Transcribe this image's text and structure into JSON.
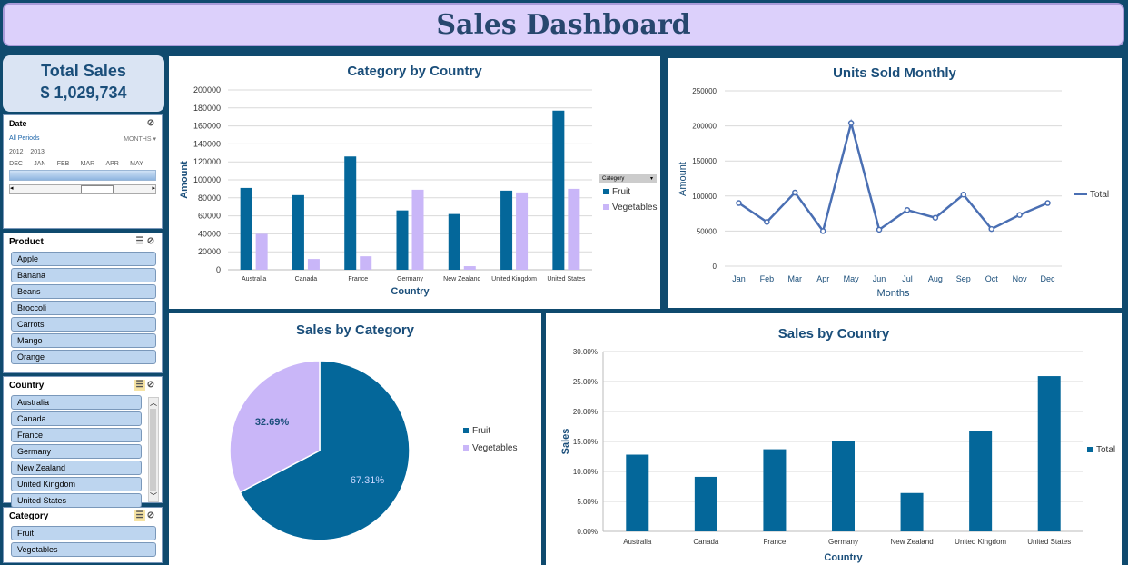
{
  "header": {
    "title": "Sales Dashboard"
  },
  "total_sales": {
    "label": "Total Sales",
    "value": "$ 1,029,734"
  },
  "date_slicer": {
    "title": "Date",
    "all_periods": "All Periods",
    "granularity": "MONTHS",
    "years": [
      "2012",
      "2013"
    ],
    "months": [
      "DEC",
      "JAN",
      "FEB",
      "MAR",
      "APR",
      "MAY"
    ]
  },
  "product_slicer": {
    "title": "Product",
    "items": [
      "Apple",
      "Banana",
      "Beans",
      "Broccoli",
      "Carrots",
      "Mango",
      "Orange"
    ]
  },
  "country_slicer": {
    "title": "Country",
    "items": [
      "Australia",
      "Canada",
      "France",
      "Germany",
      "New Zealand",
      "United Kingdom",
      "United States"
    ]
  },
  "category_slicer": {
    "title": "Category",
    "items": [
      "Fruit",
      "Vegetables"
    ]
  },
  "colors": {
    "fruit": "#04679a",
    "vegetables": "#c9b6f8",
    "line": "#4a6fb3",
    "accent": "#1a4e7a"
  },
  "chart_data": [
    {
      "type": "bar",
      "title": "Category by Country",
      "xlabel": "Country",
      "ylabel": "Amount",
      "categories": [
        "Australia",
        "Canada",
        "France",
        "Germany",
        "New Zealand",
        "United Kingdom",
        "United States"
      ],
      "series": [
        {
          "name": "Fruit",
          "values": [
            91000,
            83000,
            126000,
            66000,
            62000,
            88000,
            177000
          ]
        },
        {
          "name": "Vegetables",
          "values": [
            40000,
            12000,
            15000,
            89000,
            4000,
            86000,
            90000
          ]
        }
      ],
      "ylim": [
        0,
        200000
      ],
      "yticks": [
        "0",
        "20000",
        "40000",
        "60000",
        "80000",
        "100000",
        "120000",
        "140000",
        "160000",
        "180000",
        "200000"
      ],
      "legend_title": "Category",
      "legend": "right"
    },
    {
      "type": "line",
      "title": "Units Sold Monthly",
      "xlabel": "Months",
      "ylabel": "Amount",
      "categories": [
        "Jan",
        "Feb",
        "Mar",
        "Apr",
        "May",
        "Jun",
        "Jul",
        "Aug",
        "Sep",
        "Oct",
        "Nov",
        "Dec"
      ],
      "series": [
        {
          "name": "Total",
          "values": [
            90000,
            63000,
            105000,
            50000,
            204000,
            52000,
            80000,
            69000,
            102000,
            53000,
            73000,
            90000
          ]
        }
      ],
      "ylim": [
        0,
        250000
      ],
      "yticks": [
        "0",
        "50000",
        "100000",
        "150000",
        "200000",
        "250000"
      ],
      "legend": "right"
    },
    {
      "type": "pie",
      "title": "Sales by Category",
      "slices": [
        {
          "name": "Fruit",
          "value": 67.31,
          "label": "67.31%"
        },
        {
          "name": "Vegetables",
          "value": 32.69,
          "label": "32.69%"
        }
      ],
      "legend": "right"
    },
    {
      "type": "bar",
      "title": "Sales by Country",
      "xlabel": "Country",
      "ylabel": "Sales",
      "categories": [
        "Australia",
        "Canada",
        "France",
        "Germany",
        "New Zealand",
        "United Kingdom",
        "United States"
      ],
      "series": [
        {
          "name": "Total",
          "values": [
            12.8,
            9.1,
            13.7,
            15.1,
            6.4,
            16.8,
            25.9
          ]
        }
      ],
      "ylim": [
        0,
        30
      ],
      "yticks": [
        "0.00%",
        "5.00%",
        "10.00%",
        "15.00%",
        "20.00%",
        "25.00%",
        "30.00%"
      ],
      "legend": "right"
    }
  ]
}
